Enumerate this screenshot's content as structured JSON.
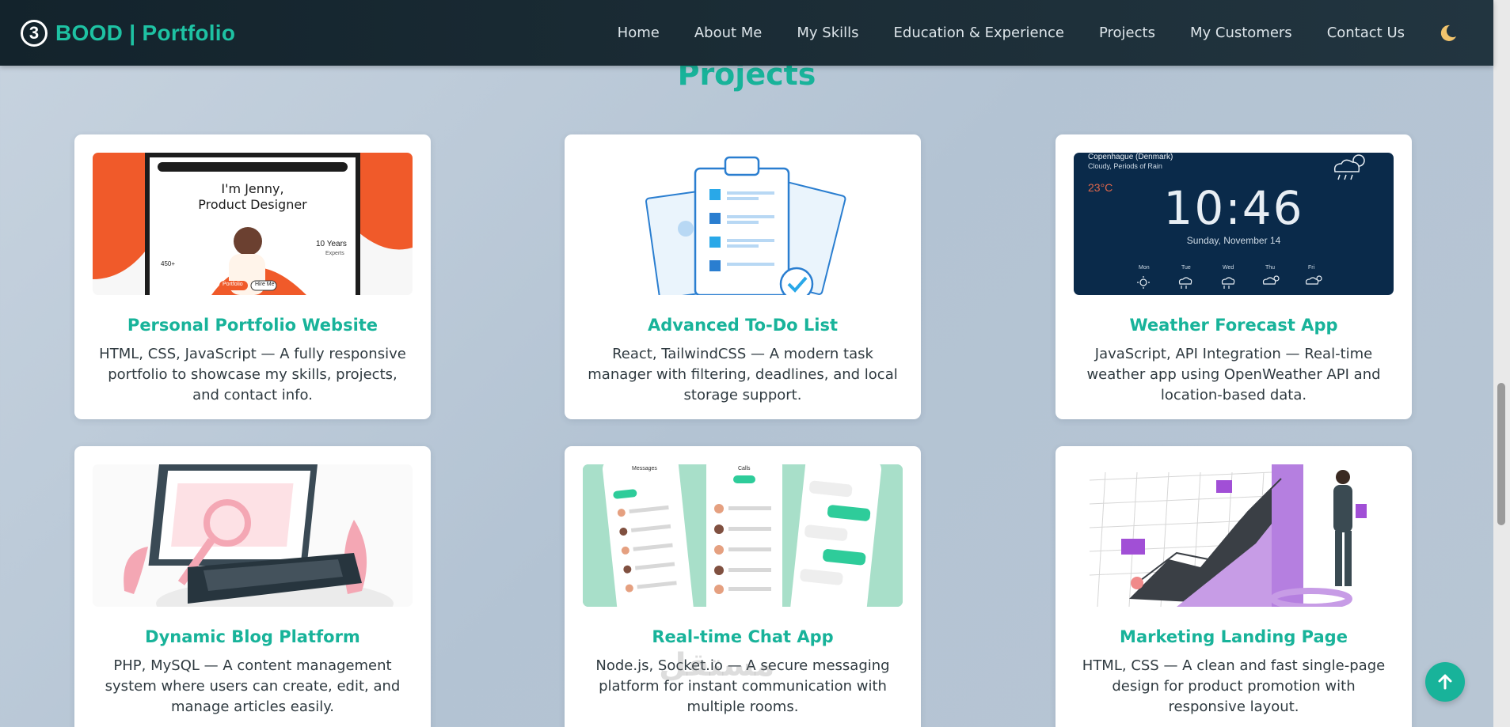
{
  "navbar": {
    "badge": "3",
    "brand": "BOOD | Portfolio",
    "links": [
      "Home",
      "About Me",
      "My Skills",
      "Education & Experience",
      "Projects",
      "My Customers",
      "Contact Us"
    ],
    "theme_icon": "moon-icon"
  },
  "section": {
    "title": "Projects"
  },
  "projects": [
    {
      "title": "Personal Portfolio Website",
      "desc": "HTML, CSS, JavaScript — A fully responsive portfolio to showcase my skills, projects, and contact info.",
      "image": {
        "hero_line1": "I'm Jenny,",
        "hero_line2": "Product Designer",
        "years": "10 Years",
        "years_sub": "Experts",
        "stat": "450+",
        "btn1": "Portfolio",
        "btn2": "Hire Me"
      }
    },
    {
      "title": "Advanced To-Do List",
      "desc": "React, TailwindCSS — A modern task manager with filtering, deadlines, and local storage support."
    },
    {
      "title": "Weather Forecast App",
      "desc": "JavaScript, API Integration — Real-time weather app using OpenWeather API and location-based data.",
      "image": {
        "city": "Copenhague (Denmark)",
        "condition": "Cloudy, Periods of Rain",
        "temp": "23°C",
        "time": "10:46",
        "date": "Sunday, November 14",
        "days": [
          "Mon",
          "Tue",
          "Wed",
          "Thu",
          "Fri"
        ]
      }
    },
    {
      "title": "Dynamic Blog Platform",
      "desc": "PHP, MySQL — A content management system where users can create, edit, and manage articles easily."
    },
    {
      "title": "Real-time Chat App",
      "desc": "Node.js, Socket.io — A secure messaging platform for instant communication with multiple rooms.",
      "image": {
        "app_title": "Messages",
        "chat_name": "Calls"
      }
    },
    {
      "title": "Marketing Landing Page",
      "desc": "HTML, CSS — A clean and fast single-page design for product promotion with responsive layout."
    }
  ],
  "watermark": "مستقل",
  "colors": {
    "accent": "#18b39a",
    "nav_bg": "#1a2b34",
    "weather_bg": "#0a2a4a",
    "chat_bg": "#a8dfc9"
  }
}
